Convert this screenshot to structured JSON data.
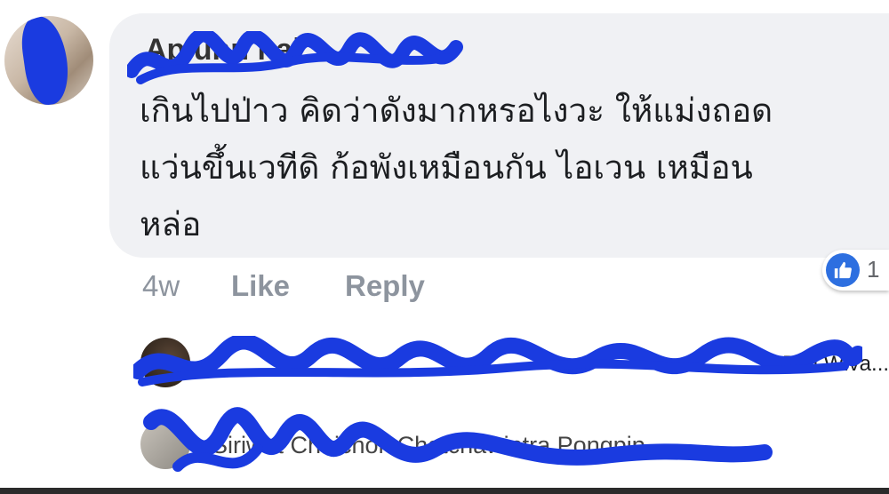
{
  "comment": {
    "author_name": "Ap   unn   hai  ",
    "text_lines": [
      "เกินไปป่าว คิดว่าดังมากหรอไงวะ ให้แม่งถอด",
      "แว่นขึ้นเวทีดิ ก้อพังเหมือนกัน ไอเวน เหมือน",
      "หล่อ"
    ],
    "timestamp": "4w",
    "like_label": "Like",
    "reply_label": "Reply",
    "reaction_count": "1",
    "reaction_icon": "like-thumb-icon"
  },
  "replies": [
    {
      "summary": "Plai Wiva..."
    },
    {
      "summary": "Siriwat Chaichok Chatchawintra Pongpip..."
    }
  ],
  "colors": {
    "bubble": "#f0f1f4",
    "meta_text": "#8d949e",
    "like_blue": "#2d6fe0",
    "redaction_blue": "#1a3be0"
  }
}
